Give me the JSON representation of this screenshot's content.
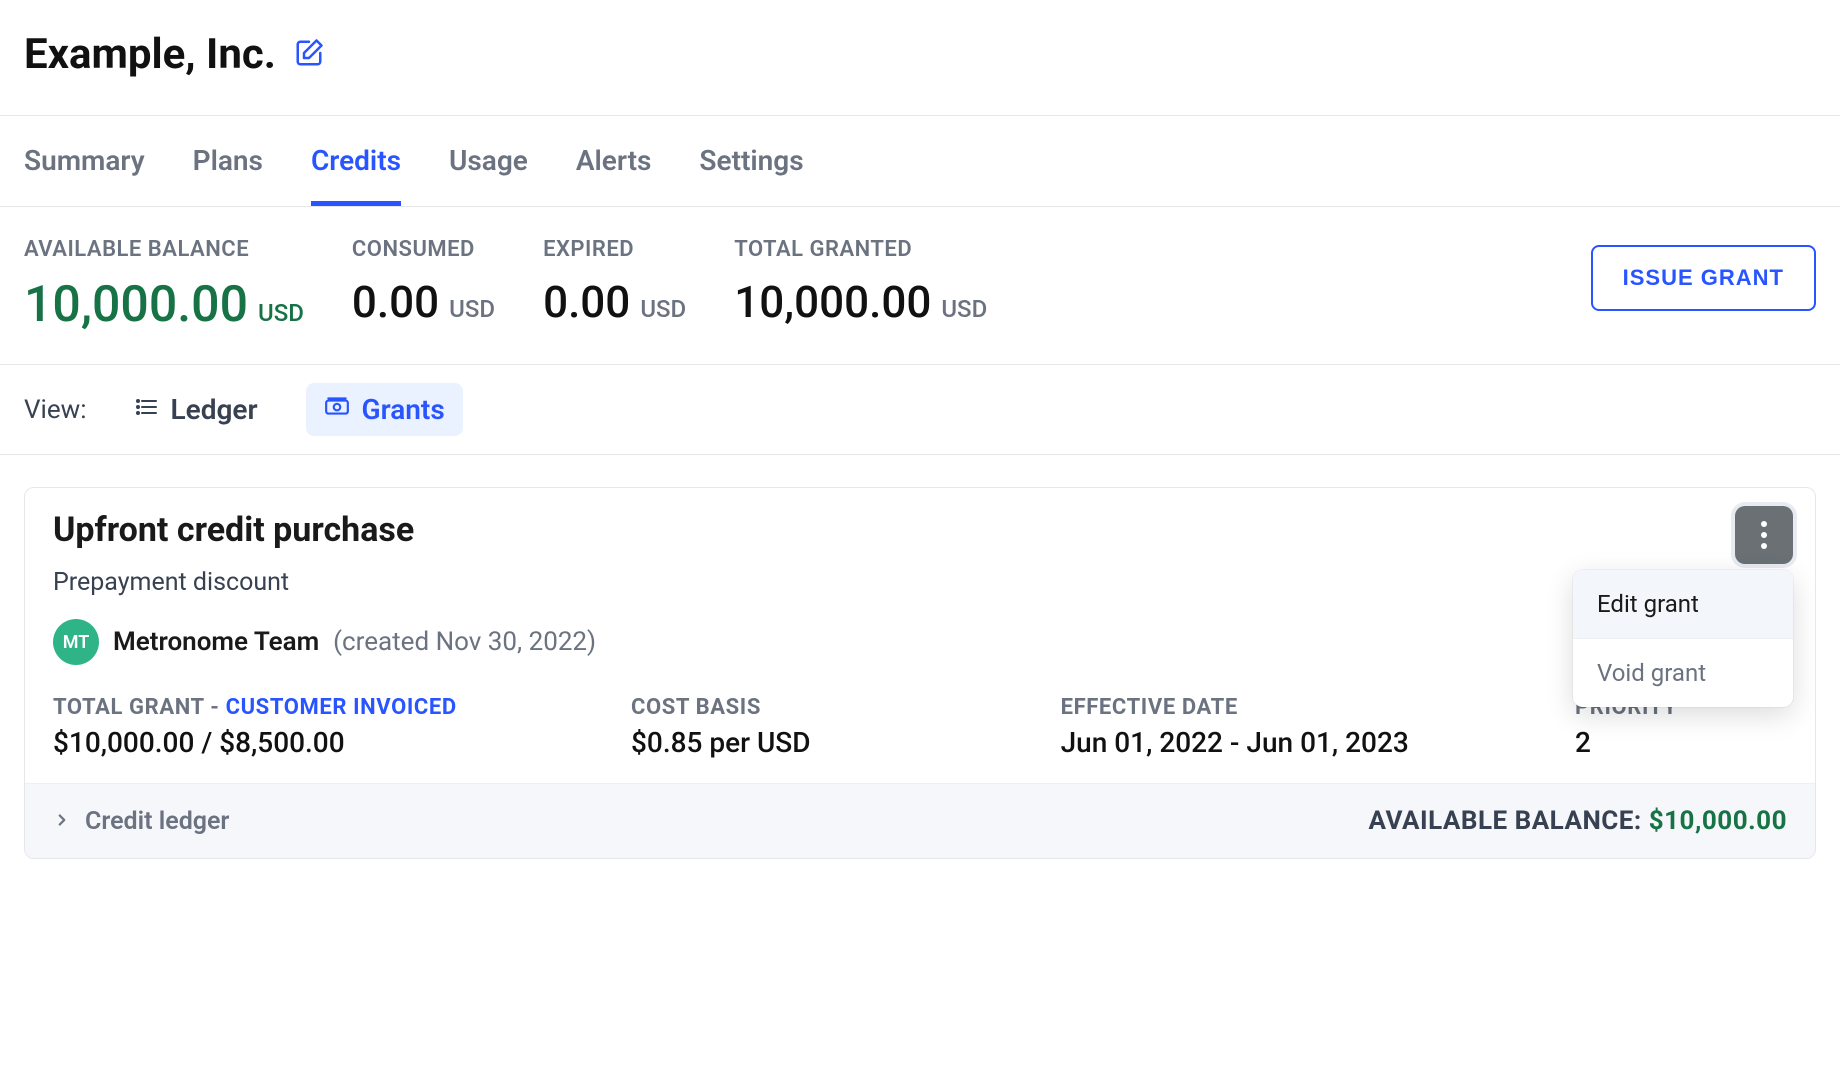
{
  "header": {
    "company": "Example, Inc."
  },
  "tabs": {
    "items": [
      {
        "label": "Summary"
      },
      {
        "label": "Plans"
      },
      {
        "label": "Credits"
      },
      {
        "label": "Usage"
      },
      {
        "label": "Alerts"
      },
      {
        "label": "Settings"
      }
    ],
    "active_index": 2
  },
  "stats": {
    "available_label": "AVAILABLE BALANCE",
    "available_value": "10,000.00",
    "available_currency": "USD",
    "consumed_label": "CONSUMED",
    "consumed_value": "0.00",
    "consumed_currency": "USD",
    "expired_label": "EXPIRED",
    "expired_value": "0.00",
    "expired_currency": "USD",
    "total_granted_label": "TOTAL GRANTED",
    "total_granted_value": "10,000.00",
    "total_granted_currency": "USD",
    "issue_grant_button": "ISSUE GRANT"
  },
  "view": {
    "label": "View:",
    "ledger": "Ledger",
    "grants": "Grants"
  },
  "grant_card": {
    "title": "Upfront credit purchase",
    "subtitle": "Prepayment discount",
    "avatar_initials": "MT",
    "creator_name": "Metronome Team",
    "created_meta": "(created Nov 30, 2022)",
    "total_grant_label": "TOTAL GRANT - ",
    "customer_invoiced_label": "CUSTOMER INVOICED",
    "total_grant_value": "$10,000.00 / $8,500.00",
    "cost_basis_label": "COST BASIS",
    "cost_basis_value": "$0.85 per USD",
    "effective_date_label": "EFFECTIVE DATE",
    "effective_date_value": "Jun 01, 2022 - Jun 01, 2023",
    "priority_label": "PRIORITY",
    "priority_value": "2",
    "credit_ledger_link": "Credit ledger",
    "footer_available_label": "AVAILABLE BALANCE: ",
    "footer_available_value": "$10,000.00",
    "menu": {
      "edit": "Edit grant",
      "void": "Void grant"
    }
  }
}
